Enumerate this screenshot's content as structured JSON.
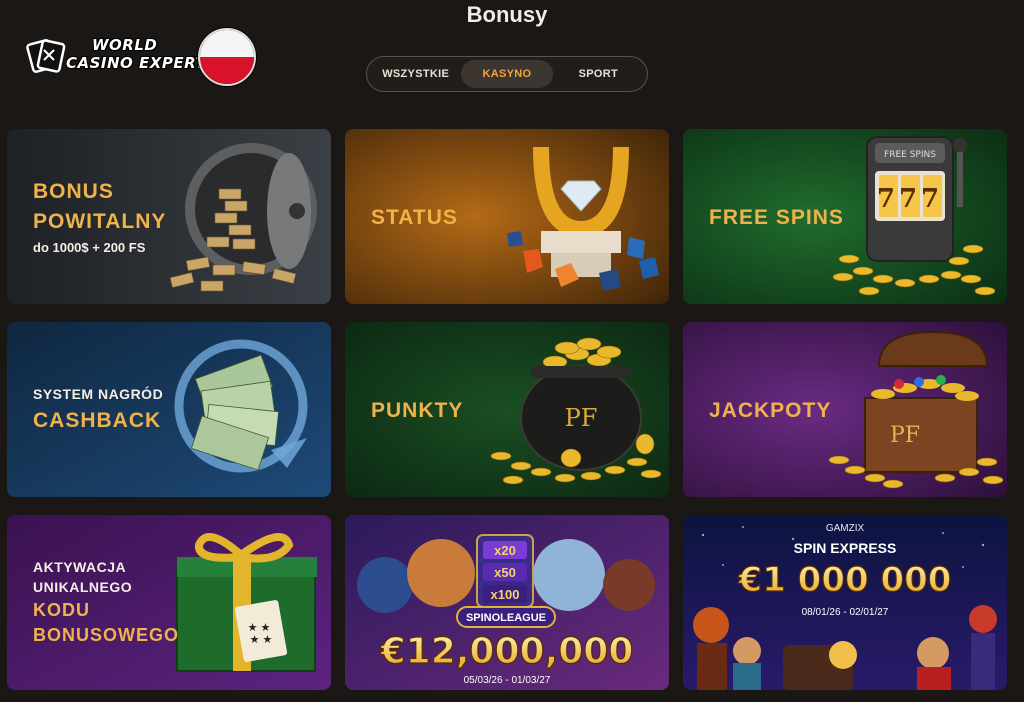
{
  "page": {
    "title": "Bonusy"
  },
  "logo": {
    "line1": "WORLD",
    "line2": "CASINO EXPERT"
  },
  "tabs": [
    {
      "label": "WSZYSTKIE",
      "active": false
    },
    {
      "label": "KASYNO",
      "active": true
    },
    {
      "label": "SPORT",
      "active": false
    }
  ],
  "cards": {
    "welcome": {
      "line1": "BONUS",
      "line2": "POWITALNY",
      "sub": "do 1000$ + 200 FS"
    },
    "status": {
      "label": "STATUS"
    },
    "free_spins": {
      "label": "FREE SPINS",
      "machine_label": "FREE SPINS",
      "reels": "777"
    },
    "cashback": {
      "line1": "SYSTEM NAGRÓD",
      "line2": "CASHBACK"
    },
    "points": {
      "label": "PUNKTY",
      "pot_label": "PF"
    },
    "jackpots": {
      "label": "JACKPOTY",
      "chest_label": "PF"
    },
    "bonus_code": {
      "line1": "AKTYWACJA",
      "line2": "UNIKALNEGO",
      "line3": "KODU",
      "line4": "BONUSOWEGO"
    },
    "spinoleague": {
      "mult1": "x20",
      "mult2": "x50",
      "mult3": "x100",
      "name": "SPINOLEAGUE",
      "amount": "€12,000,000",
      "dates": "05/03/26 - 01/03/27"
    },
    "spin_express": {
      "provider": "GAMZIX",
      "title": "SPIN EXPRESS",
      "amount": "€1 000 000",
      "dates": "08/01/26 - 02/01/27"
    }
  },
  "colors": {
    "accent": "#f0b24a",
    "active_tab": "#f0a43c",
    "background": "#1b1714"
  }
}
